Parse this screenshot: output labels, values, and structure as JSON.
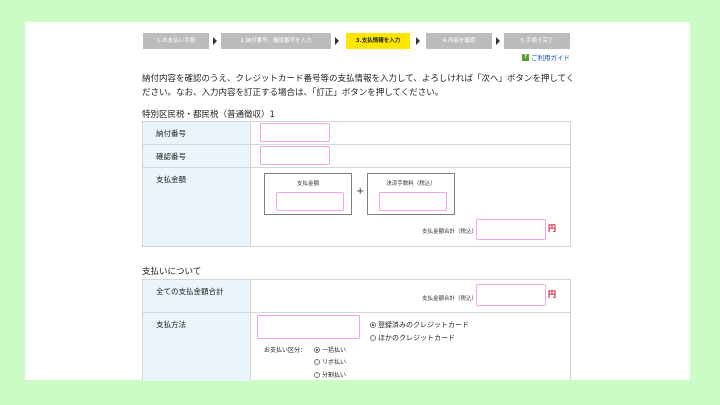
{
  "steps": [
    {
      "label": "1.お支払い手順",
      "active": false
    },
    {
      "label": "2.納付番号、確認番号を入力",
      "active": false
    },
    {
      "label": "3.支払情報を入力",
      "active": true
    },
    {
      "label": "4.内容を確認",
      "active": false
    },
    {
      "label": "5.手続き完了",
      "active": false
    }
  ],
  "guide": {
    "icon": "?",
    "label": "ご利用ガイド"
  },
  "intro": "納付内容を確認のうえ、クレジットカード番号等の支払情報を入力して、よろしければ「次へ」ボタンを押してください。なお、入力内容を訂正する場合は、「訂正」ボタンを押してください。",
  "tax_section": {
    "title": "特別区民税・都民税（普通徴収）1",
    "payment_number_label": "納付番号",
    "confirmation_number_label": "確認番号",
    "amount_label": "支払金額",
    "amount_box_label": "支払金額",
    "fee_box_label": "決済手数料（税込）",
    "plus": "+",
    "total_label": "支払金額合計（税込）",
    "yen": "円"
  },
  "payment_section": {
    "title": "支払いについて",
    "total_all_label": "全ての支払金額合計",
    "total_label": "支払金額合計（税込）",
    "yen": "円",
    "method_label": "支払方法",
    "card_options": [
      {
        "label": "登録済みのクレジットカード",
        "selected": true
      },
      {
        "label": "ほかのクレジットカード",
        "selected": false
      }
    ],
    "division_label": "お支払い区分：",
    "division_options": [
      {
        "label": "一括払い",
        "selected": true
      },
      {
        "label": "リボ払い",
        "selected": false
      },
      {
        "label": "分割払い",
        "selected": false
      }
    ]
  }
}
